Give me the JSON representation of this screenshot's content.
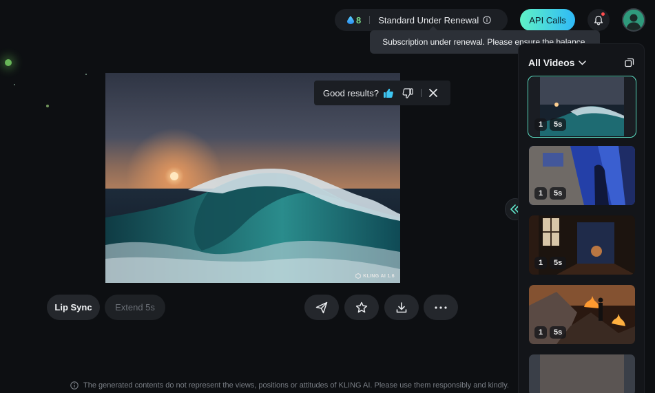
{
  "header": {
    "credits": "8",
    "plan_status": "Standard Under Renewal",
    "api_button_label": "API Calls",
    "tooltip": "Subscription under renewal. Please ensure the balance."
  },
  "player": {
    "watermark": "KLING AI 1.6",
    "feedback_prompt": "Good results?"
  },
  "actions": {
    "lip_sync_label": "Lip Sync",
    "extend_label": "Extend 5s"
  },
  "panel": {
    "title": "All Videos",
    "thumbnails": [
      {
        "count": "1",
        "duration": "5s",
        "subject": "ocean-wave"
      },
      {
        "count": "1",
        "duration": "5s",
        "subject": "ruined-wall-shadow"
      },
      {
        "count": "1",
        "duration": "5s",
        "subject": "burning-room-window"
      },
      {
        "count": "1",
        "duration": "5s",
        "subject": "fire-rubble-figure"
      }
    ]
  },
  "footer": {
    "disclaimer": "The generated contents do not represent the views, positions or attitudes of KLING AI. Please use them responsibly and kindly."
  },
  "colors": {
    "accent_start": "#5ff2c6",
    "accent_end": "#2fb9f7",
    "background": "#0d0f12",
    "credits_green": "#7ddc8a"
  }
}
